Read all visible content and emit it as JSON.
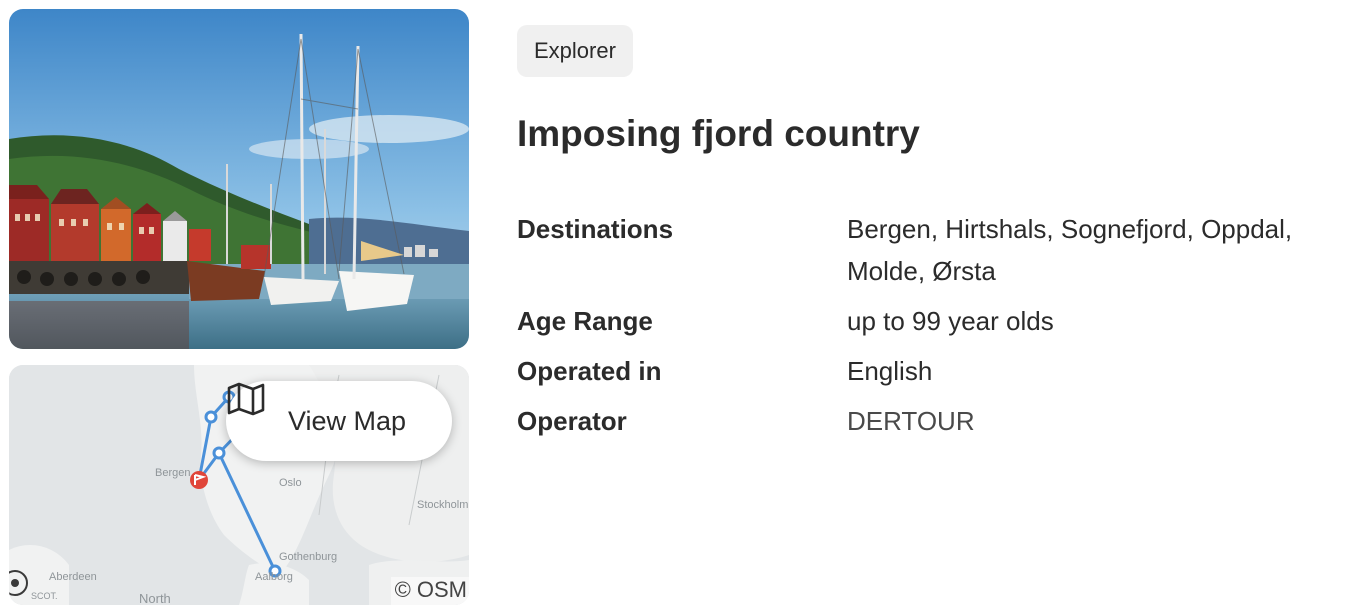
{
  "badge": "Explorer",
  "title": "Imposing fjord country",
  "details": {
    "destinations_label": "Destinations",
    "destinations_value": "Bergen, Hirtshals, Sognefjord, Oppdal, Molde, Ørsta",
    "age_label": "Age Range",
    "age_value": "up to 99 year olds",
    "language_label": "Operated in",
    "language_value": "English",
    "operator_label": "Operator",
    "operator_value": "DERTOUR"
  },
  "map": {
    "button_label": "View Map",
    "attribution": "© OSM",
    "labels": {
      "bergen": "Bergen",
      "oslo": "Oslo",
      "stockholm": "Stockholm",
      "gothenburg": "Gothenburg",
      "aalborg": "Aalborg",
      "aberdeen": "Aberdeen",
      "north": "North",
      "scot": "SCOT."
    },
    "route_color": "#4a90d9",
    "start_marker_color": "#e0463a"
  },
  "photo": {
    "icon": "harbor-photo"
  }
}
